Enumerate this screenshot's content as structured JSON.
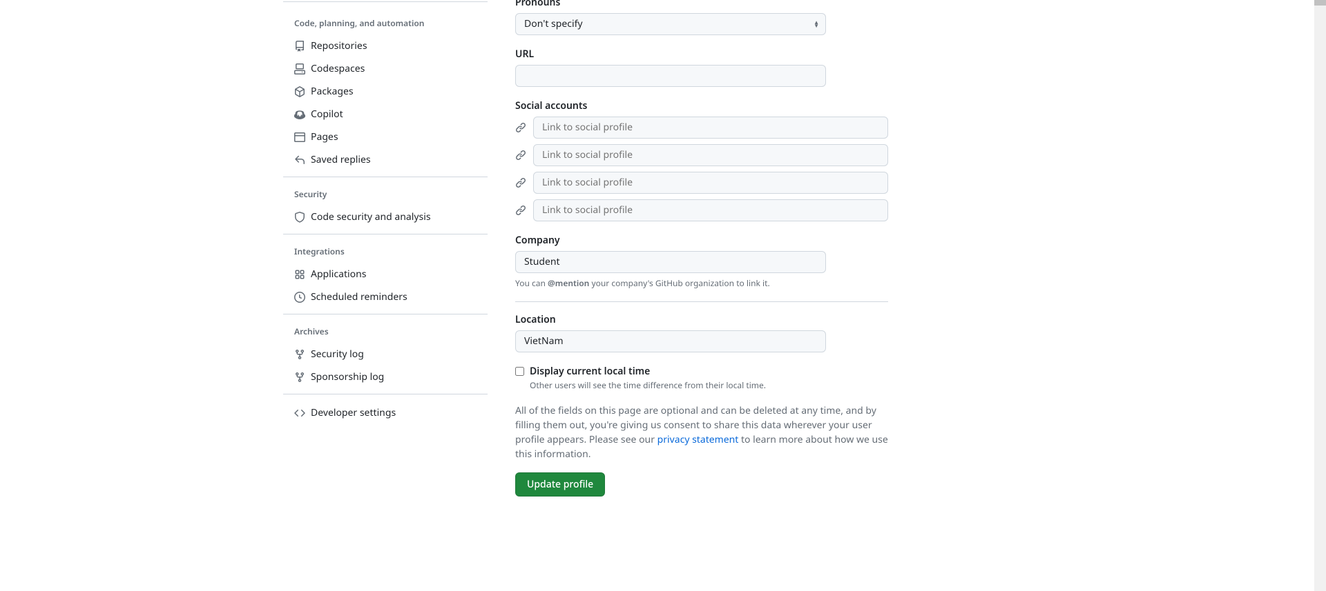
{
  "sidebar": {
    "sections": {
      "code": {
        "heading": "Code, planning, and automation",
        "items": [
          {
            "label": "Repositories"
          },
          {
            "label": "Codespaces"
          },
          {
            "label": "Packages"
          },
          {
            "label": "Copilot"
          },
          {
            "label": "Pages"
          },
          {
            "label": "Saved replies"
          }
        ]
      },
      "security": {
        "heading": "Security",
        "items": [
          {
            "label": "Code security and analysis"
          }
        ]
      },
      "integrations": {
        "heading": "Integrations",
        "items": [
          {
            "label": "Applications"
          },
          {
            "label": "Scheduled reminders"
          }
        ]
      },
      "archives": {
        "heading": "Archives",
        "items": [
          {
            "label": "Security log"
          },
          {
            "label": "Sponsorship log"
          }
        ]
      }
    },
    "developer_settings": "Developer settings"
  },
  "form": {
    "pronouns": {
      "label": "Pronouns",
      "value": "Don't specify"
    },
    "url": {
      "label": "URL",
      "value": ""
    },
    "social": {
      "label": "Social accounts",
      "placeholder": "Link to social profile"
    },
    "company": {
      "label": "Company",
      "value": "Student",
      "note_pre": "You can ",
      "note_strong": "@mention",
      "note_post": " your company's GitHub organization to link it."
    },
    "location": {
      "label": "Location",
      "value": "VietNam"
    },
    "localtime": {
      "label": "Display current local time",
      "sub": "Other users will see the time difference from their local time."
    },
    "consent": {
      "pre": "All of the fields on this page are optional and can be deleted at any time, and by filling them out, you're giving us consent to share this data wherever your user profile appears. Please see our ",
      "link": "privacy statement",
      "post": " to learn more about how we use this information."
    },
    "submit": "Update profile"
  }
}
